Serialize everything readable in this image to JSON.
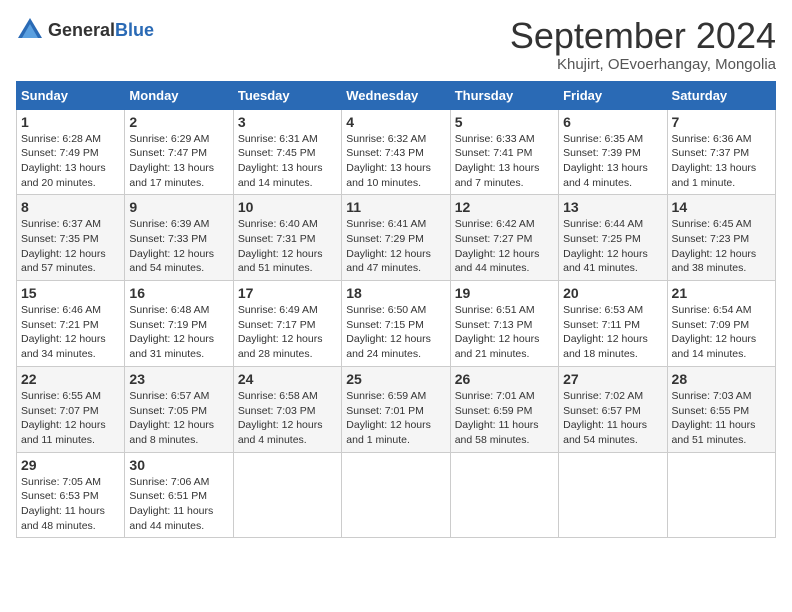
{
  "header": {
    "logo_general": "General",
    "logo_blue": "Blue",
    "title": "September 2024",
    "subtitle": "Khujirt, OEvoerhangay, Mongolia"
  },
  "calendar": {
    "days_of_week": [
      "Sunday",
      "Monday",
      "Tuesday",
      "Wednesday",
      "Thursday",
      "Friday",
      "Saturday"
    ],
    "weeks": [
      [
        {
          "day": "",
          "empty": true
        },
        {
          "day": "",
          "empty": true
        },
        {
          "day": "",
          "empty": true
        },
        {
          "day": "",
          "empty": true
        },
        {
          "day": "",
          "empty": true
        },
        {
          "day": "",
          "empty": true
        },
        {
          "day": "",
          "empty": true
        }
      ],
      [
        {
          "day": "1",
          "sunrise": "Sunrise: 6:28 AM",
          "sunset": "Sunset: 7:49 PM",
          "daylight": "Daylight: 13 hours and 20 minutes."
        },
        {
          "day": "2",
          "sunrise": "Sunrise: 6:29 AM",
          "sunset": "Sunset: 7:47 PM",
          "daylight": "Daylight: 13 hours and 17 minutes."
        },
        {
          "day": "3",
          "sunrise": "Sunrise: 6:31 AM",
          "sunset": "Sunset: 7:45 PM",
          "daylight": "Daylight: 13 hours and 14 minutes."
        },
        {
          "day": "4",
          "sunrise": "Sunrise: 6:32 AM",
          "sunset": "Sunset: 7:43 PM",
          "daylight": "Daylight: 13 hours and 10 minutes."
        },
        {
          "day": "5",
          "sunrise": "Sunrise: 6:33 AM",
          "sunset": "Sunset: 7:41 PM",
          "daylight": "Daylight: 13 hours and 7 minutes."
        },
        {
          "day": "6",
          "sunrise": "Sunrise: 6:35 AM",
          "sunset": "Sunset: 7:39 PM",
          "daylight": "Daylight: 13 hours and 4 minutes."
        },
        {
          "day": "7",
          "sunrise": "Sunrise: 6:36 AM",
          "sunset": "Sunset: 7:37 PM",
          "daylight": "Daylight: 13 hours and 1 minute."
        }
      ],
      [
        {
          "day": "8",
          "sunrise": "Sunrise: 6:37 AM",
          "sunset": "Sunset: 7:35 PM",
          "daylight": "Daylight: 12 hours and 57 minutes."
        },
        {
          "day": "9",
          "sunrise": "Sunrise: 6:39 AM",
          "sunset": "Sunset: 7:33 PM",
          "daylight": "Daylight: 12 hours and 54 minutes."
        },
        {
          "day": "10",
          "sunrise": "Sunrise: 6:40 AM",
          "sunset": "Sunset: 7:31 PM",
          "daylight": "Daylight: 12 hours and 51 minutes."
        },
        {
          "day": "11",
          "sunrise": "Sunrise: 6:41 AM",
          "sunset": "Sunset: 7:29 PM",
          "daylight": "Daylight: 12 hours and 47 minutes."
        },
        {
          "day": "12",
          "sunrise": "Sunrise: 6:42 AM",
          "sunset": "Sunset: 7:27 PM",
          "daylight": "Daylight: 12 hours and 44 minutes."
        },
        {
          "day": "13",
          "sunrise": "Sunrise: 6:44 AM",
          "sunset": "Sunset: 7:25 PM",
          "daylight": "Daylight: 12 hours and 41 minutes."
        },
        {
          "day": "14",
          "sunrise": "Sunrise: 6:45 AM",
          "sunset": "Sunset: 7:23 PM",
          "daylight": "Daylight: 12 hours and 38 minutes."
        }
      ],
      [
        {
          "day": "15",
          "sunrise": "Sunrise: 6:46 AM",
          "sunset": "Sunset: 7:21 PM",
          "daylight": "Daylight: 12 hours and 34 minutes."
        },
        {
          "day": "16",
          "sunrise": "Sunrise: 6:48 AM",
          "sunset": "Sunset: 7:19 PM",
          "daylight": "Daylight: 12 hours and 31 minutes."
        },
        {
          "day": "17",
          "sunrise": "Sunrise: 6:49 AM",
          "sunset": "Sunset: 7:17 PM",
          "daylight": "Daylight: 12 hours and 28 minutes."
        },
        {
          "day": "18",
          "sunrise": "Sunrise: 6:50 AM",
          "sunset": "Sunset: 7:15 PM",
          "daylight": "Daylight: 12 hours and 24 minutes."
        },
        {
          "day": "19",
          "sunrise": "Sunrise: 6:51 AM",
          "sunset": "Sunset: 7:13 PM",
          "daylight": "Daylight: 12 hours and 21 minutes."
        },
        {
          "day": "20",
          "sunrise": "Sunrise: 6:53 AM",
          "sunset": "Sunset: 7:11 PM",
          "daylight": "Daylight: 12 hours and 18 minutes."
        },
        {
          "day": "21",
          "sunrise": "Sunrise: 6:54 AM",
          "sunset": "Sunset: 7:09 PM",
          "daylight": "Daylight: 12 hours and 14 minutes."
        }
      ],
      [
        {
          "day": "22",
          "sunrise": "Sunrise: 6:55 AM",
          "sunset": "Sunset: 7:07 PM",
          "daylight": "Daylight: 12 hours and 11 minutes."
        },
        {
          "day": "23",
          "sunrise": "Sunrise: 6:57 AM",
          "sunset": "Sunset: 7:05 PM",
          "daylight": "Daylight: 12 hours and 8 minutes."
        },
        {
          "day": "24",
          "sunrise": "Sunrise: 6:58 AM",
          "sunset": "Sunset: 7:03 PM",
          "daylight": "Daylight: 12 hours and 4 minutes."
        },
        {
          "day": "25",
          "sunrise": "Sunrise: 6:59 AM",
          "sunset": "Sunset: 7:01 PM",
          "daylight": "Daylight: 12 hours and 1 minute."
        },
        {
          "day": "26",
          "sunrise": "Sunrise: 7:01 AM",
          "sunset": "Sunset: 6:59 PM",
          "daylight": "Daylight: 11 hours and 58 minutes."
        },
        {
          "day": "27",
          "sunrise": "Sunrise: 7:02 AM",
          "sunset": "Sunset: 6:57 PM",
          "daylight": "Daylight: 11 hours and 54 minutes."
        },
        {
          "day": "28",
          "sunrise": "Sunrise: 7:03 AM",
          "sunset": "Sunset: 6:55 PM",
          "daylight": "Daylight: 11 hours and 51 minutes."
        }
      ],
      [
        {
          "day": "29",
          "sunrise": "Sunrise: 7:05 AM",
          "sunset": "Sunset: 6:53 PM",
          "daylight": "Daylight: 11 hours and 48 minutes."
        },
        {
          "day": "30",
          "sunrise": "Sunrise: 7:06 AM",
          "sunset": "Sunset: 6:51 PM",
          "daylight": "Daylight: 11 hours and 44 minutes."
        },
        {
          "day": "",
          "empty": true
        },
        {
          "day": "",
          "empty": true
        },
        {
          "day": "",
          "empty": true
        },
        {
          "day": "",
          "empty": true
        },
        {
          "day": "",
          "empty": true
        }
      ]
    ]
  }
}
